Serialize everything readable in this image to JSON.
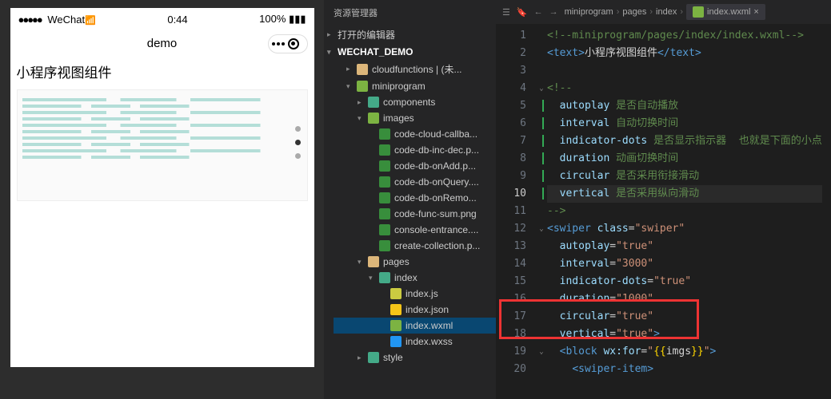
{
  "simulator": {
    "carrier": "WeChat",
    "time": "0:44",
    "battery": "100%",
    "app_title": "demo",
    "page_heading": "小程序视图组件"
  },
  "explorer": {
    "title": "资源管理器",
    "sections": {
      "open_editors": "打开的编辑器",
      "project": "WECHAT_DEMO"
    },
    "tree": [
      {
        "label": "cloudfunctions | (未...",
        "icon": "folder-y",
        "indent": 1,
        "expanded": false
      },
      {
        "label": "miniprogram",
        "icon": "folder-g",
        "indent": 1,
        "expanded": true
      },
      {
        "label": "components",
        "icon": "folder",
        "indent": 2,
        "expanded": false
      },
      {
        "label": "images",
        "icon": "folder-g",
        "indent": 2,
        "expanded": true
      },
      {
        "label": "code-cloud-callba...",
        "icon": "img",
        "indent": 3
      },
      {
        "label": "code-db-inc-dec.p...",
        "icon": "img",
        "indent": 3
      },
      {
        "label": "code-db-onAdd.p...",
        "icon": "img",
        "indent": 3
      },
      {
        "label": "code-db-onQuery....",
        "icon": "img",
        "indent": 3
      },
      {
        "label": "code-db-onRemo...",
        "icon": "img",
        "indent": 3
      },
      {
        "label": "code-func-sum.png",
        "icon": "img",
        "indent": 3
      },
      {
        "label": "console-entrance....",
        "icon": "img",
        "indent": 3
      },
      {
        "label": "create-collection.p...",
        "icon": "img",
        "indent": 3
      },
      {
        "label": "pages",
        "icon": "folder-y",
        "indent": 2,
        "expanded": true
      },
      {
        "label": "index",
        "icon": "folder",
        "indent": 3,
        "expanded": true
      },
      {
        "label": "index.js",
        "icon": "js",
        "indent": 4
      },
      {
        "label": "index.json",
        "icon": "json",
        "indent": 4
      },
      {
        "label": "index.wxml",
        "icon": "wxml",
        "indent": 4,
        "selected": true
      },
      {
        "label": "index.wxss",
        "icon": "wxss",
        "indent": 4
      },
      {
        "label": "style",
        "icon": "folder",
        "indent": 2,
        "expanded": false
      }
    ]
  },
  "editor": {
    "breadcrumb": [
      "miniprogram",
      "pages",
      "index",
      "index.wxml"
    ],
    "lines": [
      {
        "n": 1,
        "html": "<span class='c-comment'>&lt;!--miniprogram/pages/index/index.wxml--&gt;</span>"
      },
      {
        "n": 2,
        "html": "<span class='c-tag'>&lt;text&gt;</span><span class='c-text'>小程序视图组件</span><span class='c-tag'>&lt;/text&gt;</span>"
      },
      {
        "n": 3,
        "html": ""
      },
      {
        "n": 4,
        "html": "<span class='c-comment'>&lt;!--</span>",
        "fold": "v"
      },
      {
        "n": 5,
        "html": "  <span class='c-attr'>autoplay</span> <span class='c-comment'>是否自动播放</span>",
        "bl": true
      },
      {
        "n": 6,
        "html": "  <span class='c-attr'>interval</span> <span class='c-comment'>自动切换时间</span>",
        "bl": true
      },
      {
        "n": 7,
        "html": "  <span class='c-attr'>indicator-dots</span> <span class='c-comment'>是否显示指示器  也就是下面的小点</span>",
        "bl": true
      },
      {
        "n": 8,
        "html": "  <span class='c-attr'>duration</span> <span class='c-comment'>动画切换时间</span>",
        "bl": true
      },
      {
        "n": 9,
        "html": "  <span class='c-attr'>circular</span> <span class='c-comment'>是否采用衔接滑动</span>",
        "bl": true
      },
      {
        "n": 10,
        "html": "  <span class='c-attr'>vertical</span> <span class='c-comment'>是否采用纵向滑动</span>",
        "bl": true,
        "hl": true
      },
      {
        "n": 11,
        "html": "<span class='c-comment'>--&gt;</span>"
      },
      {
        "n": 12,
        "html": "<span class='c-tag'>&lt;swiper</span> <span class='c-attr'>class</span>=<span class='c-str'>\"swiper\"</span>",
        "fold": "v"
      },
      {
        "n": 13,
        "html": "  <span class='c-attr'>autoplay</span>=<span class='c-str'>\"true\"</span>"
      },
      {
        "n": 14,
        "html": "  <span class='c-attr'>interval</span>=<span class='c-str'>\"3000\"</span>"
      },
      {
        "n": 15,
        "html": "  <span class='c-attr'>indicator-dots</span>=<span class='c-str'>\"true\"</span>"
      },
      {
        "n": 16,
        "html": "  <span class='c-attr'>duration</span>=<span class='c-str'>\"1000\"</span>"
      },
      {
        "n": 17,
        "html": "  <span class='c-attr'>circular</span>=<span class='c-str'>\"true\"</span>"
      },
      {
        "n": 18,
        "html": "  <span class='c-attr'>vertical</span>=<span class='c-str'>\"true\"</span><span class='c-tag'>&gt;</span>"
      },
      {
        "n": 19,
        "html": "  <span class='c-tag'>&lt;block</span> <span class='c-attr'>wx:for</span>=<span class='c-str'>\"</span><span class='c-brace'>{{</span><span class='c-text'>imgs</span><span class='c-brace'>}}</span><span class='c-str'>\"</span><span class='c-tag'>&gt;</span>",
        "fold": "v"
      },
      {
        "n": 20,
        "html": "    <span class='c-tag'>&lt;swiper-item&gt;</span>"
      }
    ]
  }
}
